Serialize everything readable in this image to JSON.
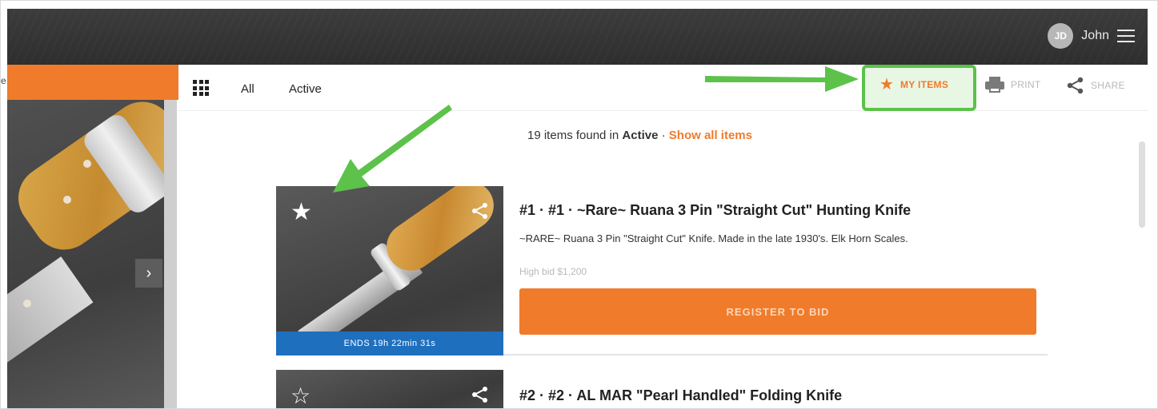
{
  "header": {
    "user": {
      "initials": "JD",
      "name": "John"
    }
  },
  "left": {
    "edge_text": "e"
  },
  "nav": {
    "tabs": [
      {
        "label": "All"
      },
      {
        "label": "Active"
      }
    ],
    "actions": {
      "my_items": "MY ITEMS",
      "print": "PRINT",
      "share": "SHARE"
    }
  },
  "results": {
    "count_text": "19 items found in",
    "filter": "Active",
    "separator": "·",
    "show_all": "Show all items"
  },
  "items": [
    {
      "title": "#1 · #1 · ~Rare~ Ruana 3 Pin \"Straight Cut\" Hunting Knife",
      "description": "~RARE~ Ruana 3 Pin \"Straight Cut\" Knife. Made in the late 1930's. Elk Horn Scales.",
      "high_bid": "High bid $1,200",
      "cta": "REGISTER TO BID",
      "ends": "ENDS 19h 22min 31s",
      "favorite_icon": "star-filled"
    },
    {
      "title": "#2 · #2 · AL MAR \"Pearl Handled\" Folding Knife",
      "favorite_icon": "star-outline"
    }
  ],
  "colors": {
    "accent": "#f07b2a",
    "highlight": "#5cc24a",
    "ends_bar": "#1f6fbf",
    "topbar": "#333333"
  }
}
